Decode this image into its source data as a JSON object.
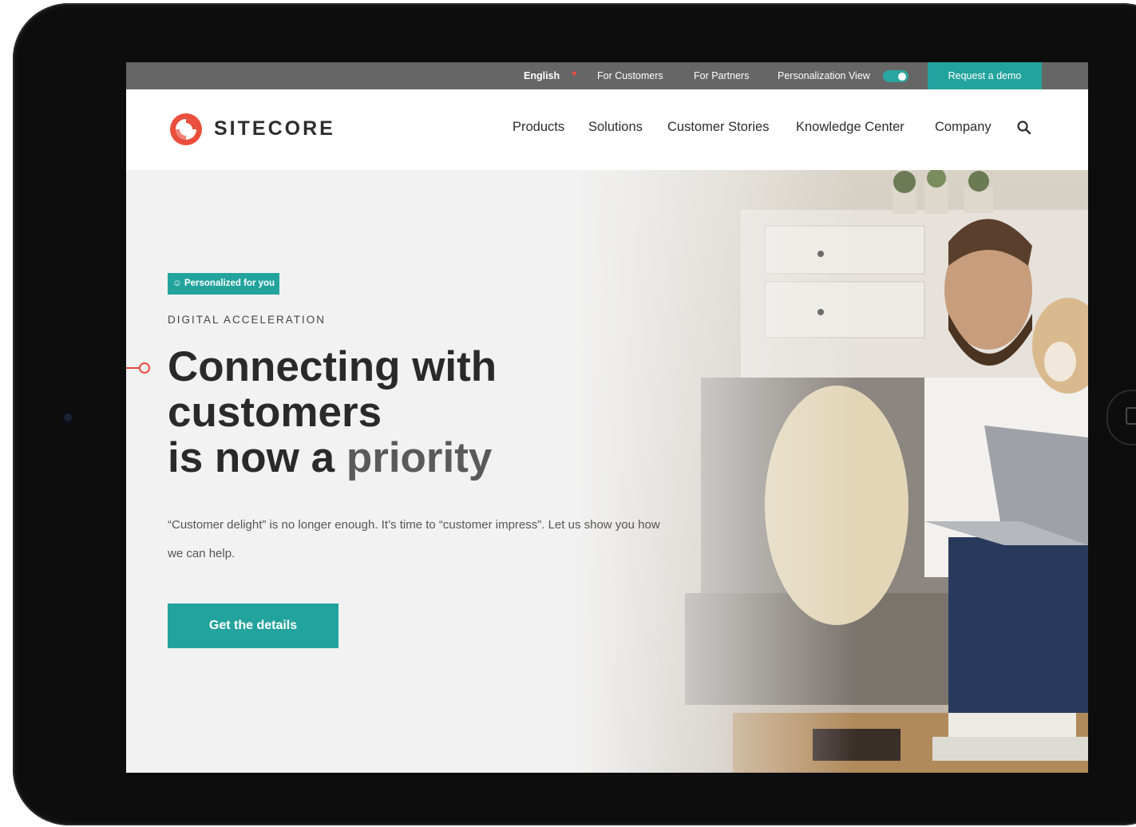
{
  "topbar": {
    "language": "English",
    "for_customers": "For Customers",
    "for_partners": "For Partners",
    "personalization_view": "Personalization View",
    "request_demo": "Request a demo"
  },
  "header": {
    "logo_text": "SITECORE",
    "nav": [
      "Products",
      "Solutions",
      "Customer Stories",
      "Knowledge Center",
      "Company"
    ],
    "search_icon": "search-icon"
  },
  "hero": {
    "badge": "Personalized for you",
    "eyebrow": "DIGITAL ACCELERATION",
    "headline_line1": "Connecting with",
    "headline_line2": "customers",
    "headline_line3_a": "is now a ",
    "headline_line3_b": "priority",
    "lead": "“Customer delight” is no longer enough. It’s time to “customer impress”. Let us show you how we can help.",
    "cta": "Get the details"
  },
  "colors": {
    "accent": "#23a39d",
    "brand_red": "#e94e3c",
    "topbar": "#666666"
  }
}
